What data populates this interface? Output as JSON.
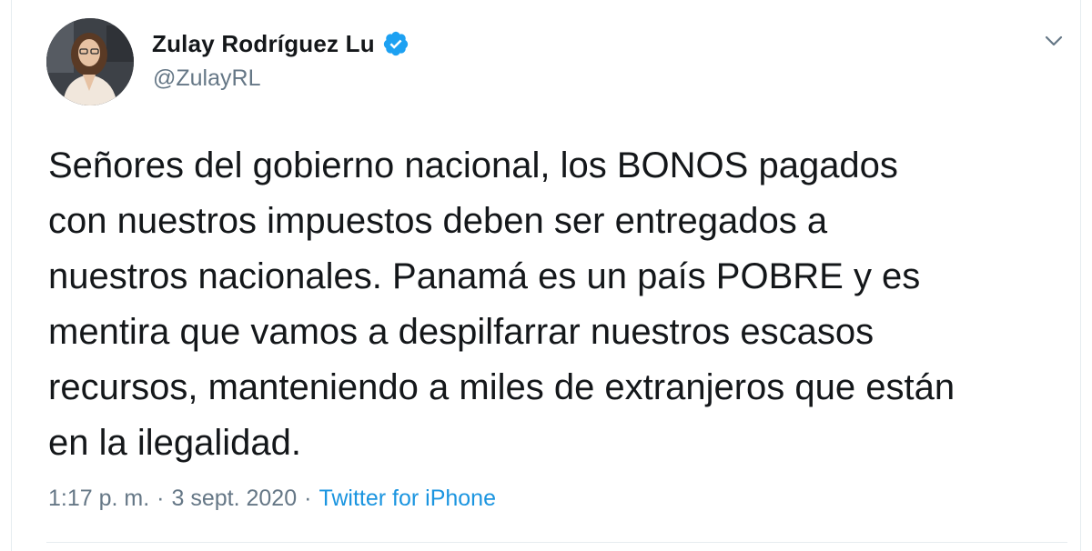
{
  "author": {
    "name": "Zulay Rodríguez Lu",
    "handle": "@ZulayRL",
    "verified": true
  },
  "tweet": {
    "lines": [
      "Señores del gobierno nacional, los BONOS pagados",
      "con nuestros impuestos deben ser entregados a",
      "nuestros nacionales. Panamá es un país POBRE y es",
      "mentira que vamos a despilfarrar nuestros escasos",
      "recursos, manteniendo a miles de extranjeros que están",
      "en la ilegalidad."
    ]
  },
  "meta": {
    "time": "1:17 p. m.",
    "separator": "·",
    "date": "3 sept. 2020",
    "source": "Twitter for iPhone"
  },
  "colors": {
    "text": "#14171a",
    "secondary": "#657786",
    "link": "#1b95e0",
    "verified": "#1da1f2",
    "divider": "#e6ecf0"
  },
  "icons": {
    "verified": "verified-badge-icon",
    "caret": "chevron-down-icon"
  }
}
